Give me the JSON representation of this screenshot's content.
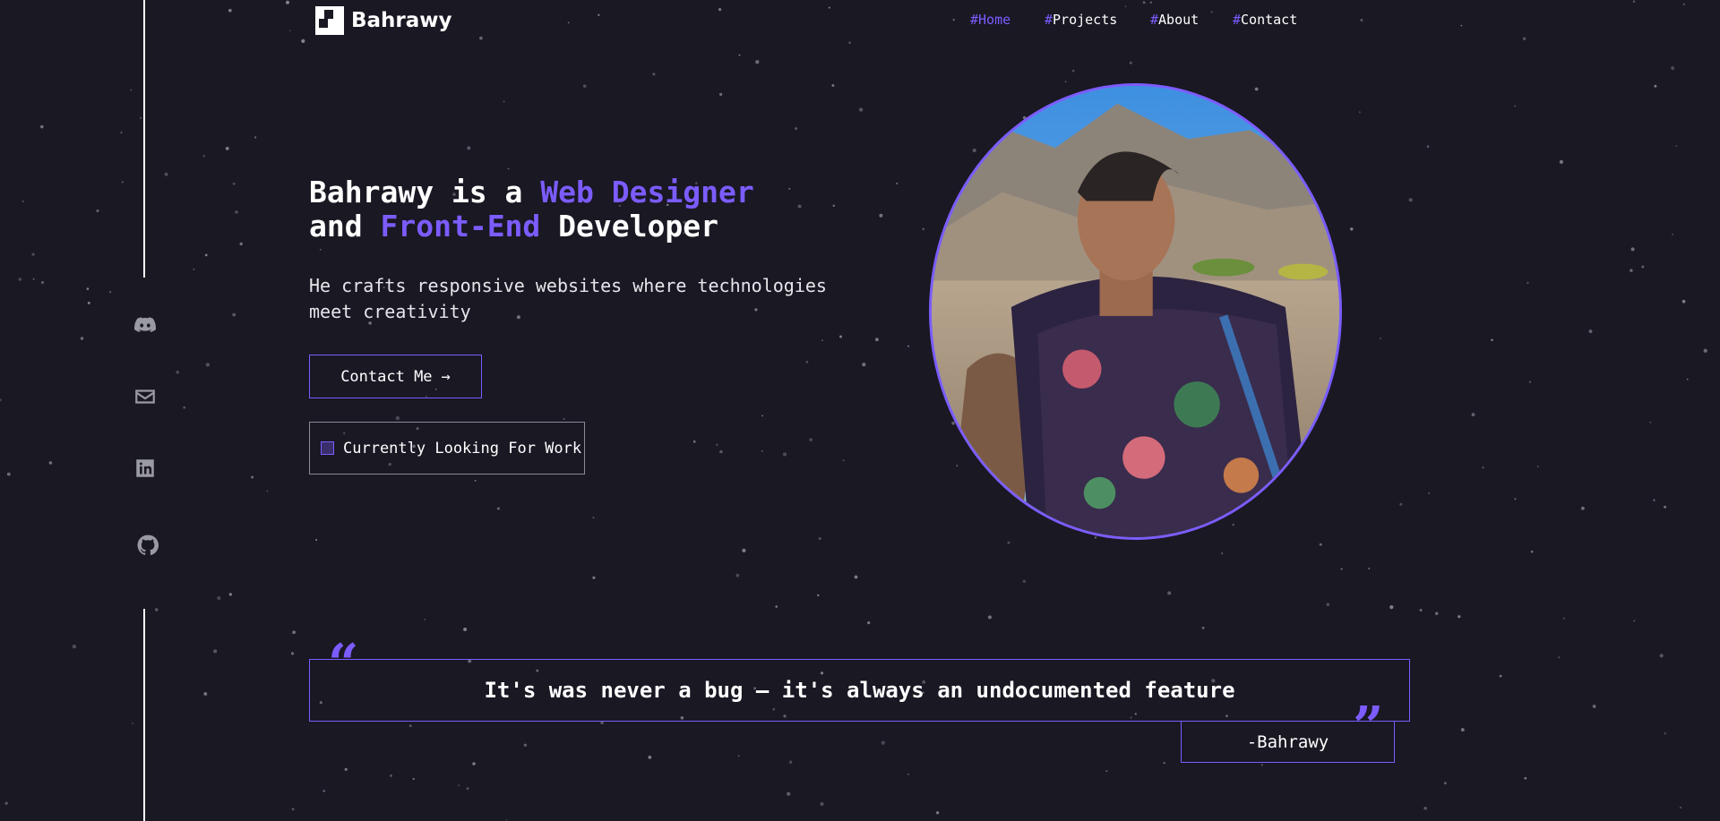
{
  "brand": {
    "name": "Bahrawy"
  },
  "nav": {
    "items": [
      {
        "hash": "#",
        "label": "Home"
      },
      {
        "hash": "#",
        "label": "Projects"
      },
      {
        "hash": "#",
        "label": "About"
      },
      {
        "hash": "#",
        "label": "Contact"
      }
    ]
  },
  "social": {
    "icons": [
      "discord-icon",
      "mail-icon",
      "linkedin-icon",
      "github-icon"
    ]
  },
  "hero": {
    "line1_a": "Bahrawy is a ",
    "line1_b": "Web Designer",
    "line2_a": "and ",
    "line2_b": "Front-End",
    "line2_c": " Developer",
    "subtitle": "He crafts responsive websites where technologies meet creativity",
    "cta_label": "Contact Me",
    "cta_arrow": "→",
    "status_label": "Currently Looking For Work"
  },
  "quote": {
    "open_mark": "“",
    "close_mark": "”",
    "text": "It's was never a bug — it's always an undocumented feature",
    "author": "-Bahrawy"
  },
  "colors": {
    "background": "#191823",
    "accent": "#7c5cff",
    "text": "#ffffff",
    "muted_icon": "#9a9aa2"
  }
}
